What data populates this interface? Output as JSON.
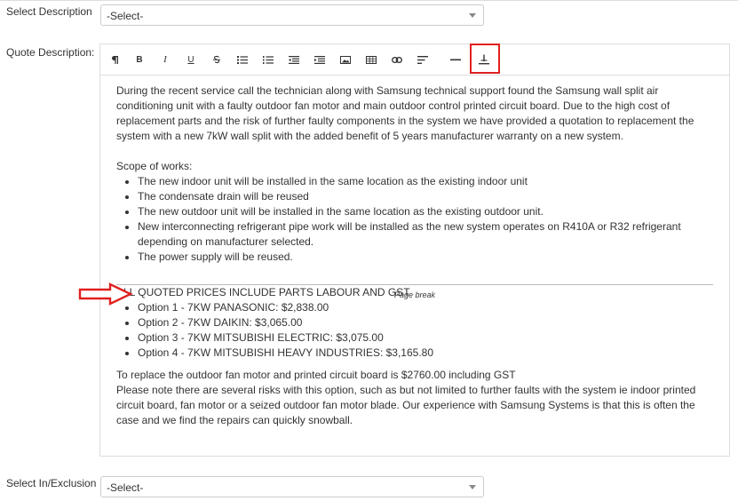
{
  "form": {
    "select_description_label": "Select Description",
    "select_description_value": "-Select-",
    "quote_description_label": "Quote Description:",
    "select_inexclusion_label": "Select In/Exclusion",
    "select_inexclusion_value": "-Select-"
  },
  "toolbar": {
    "icons": [
      "paragraph-icon",
      "bold-icon",
      "italic-icon",
      "underline-icon",
      "strikethrough-icon",
      "unordered-list-icon",
      "ordered-list-icon",
      "outdent-icon",
      "indent-icon",
      "image-icon",
      "table-icon",
      "link-icon",
      "align-icon",
      "horizontal-rule-icon",
      "page-break-icon"
    ],
    "bold": "B",
    "italic": "I",
    "underline": "U",
    "highlight_color": "#e02020"
  },
  "editor": {
    "intro": "During the recent service call the technician along with Samsung technical support found the Samsung wall split air conditioning unit with a faulty outdoor fan motor and main outdoor control printed circuit board. Due to the high cost of replacement parts and the risk of further faulty components in the system we have provided a quotation to replacement the system with a new 7kW wall split with the added benefit of 5 years manufacturer warranty on a new system.",
    "scope_heading": "Scope of works:",
    "scope_items": [
      "The new indoor unit will be installed in the same location as the existing indoor unit",
      "The condensate drain will be reused",
      "The new outdoor unit will be installed in the same location as the existing outdoor unit.",
      "New interconnecting refrigerant pipe work will be installed as the new system operates on R410A or R32 refrigerant depending on manufacturer selected.",
      "The power supply will be reused."
    ],
    "page_break_label": "Page break",
    "prices_heading": "ALL QUOTED PRICES INCLUDE PARTS LABOUR AND GST",
    "options": [
      "Option 1 - 7KW PANASONIC: $2,838.00",
      "Option 2 - 7KW DAIKIN: $3,065.00",
      "Option 3 - 7KW MITSUBISHI ELECTRIC: $3,075.00",
      "Option 4 - 7KW MITSUBISHI HEAVY INDUSTRIES: $3,165.80"
    ],
    "repair_line": "To replace the outdoor fan motor and printed circuit board is $2760.00 including GST",
    "risk_note": "Please note there are several risks with this option, such as but not limited to further faults with the system ie indoor printed circuit board, fan motor or a seized outdoor fan motor blade. Our experience with Samsung Systems is that this is often the case and we find the repairs can quickly snowball."
  },
  "annotation": {
    "arrow_color": "#e02020"
  }
}
